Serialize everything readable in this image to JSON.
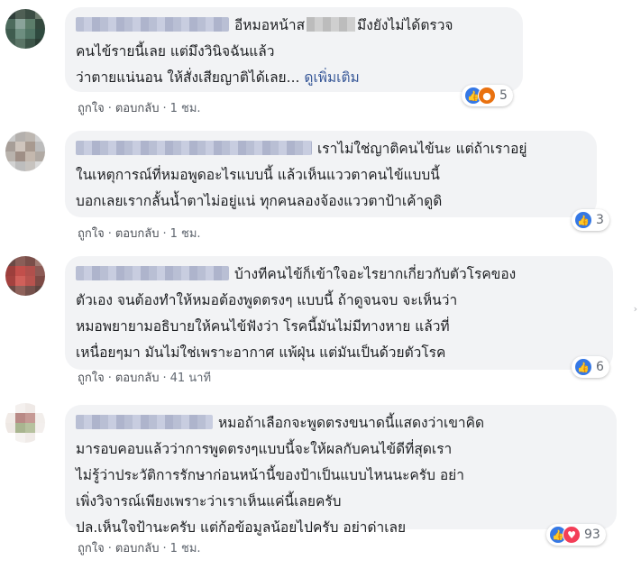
{
  "actions": {
    "like_label": "ถูกใจ",
    "reply_label": "ตอบกลับ"
  },
  "comments": [
    {
      "lines": [
        "อีหมอหน้าส",
        "มึงยังไม่ได้ตรวจ",
        "คนไข้รายนี้เลย แต่มึงวินิจฉันแล้ว",
        "ว่าตายแน่นอน ให้สั่งเสียญาติได้เลย..."
      ],
      "see_more": "ดูเพิ่มเติม",
      "reaction_count": "5",
      "time": "1 ชม."
    },
    {
      "lines": [
        "เราไม่ใช่ญาติคนไข้นะ แต่ถ้าเราอยู่",
        "ในเหตุการณ์ที่หมอพูดอะไรแบบนี้ แล้วเห็นแววตาคนไข้แบบนี้",
        "บอกเลยเรากลั้นน้ำตาไม่อยู่แน่ ทุกคนลองจ้องแววตาป้าเค้าดูดิ"
      ],
      "reaction_count": "3",
      "time": "1 ชม."
    },
    {
      "lines": [
        "บ้างทีคนไข้ก็เข้าใจอะไรยากเกี่ยวกับตัวโรคของ",
        "ตัวเอง จนต้องทำให้หมอต้องพูดตรงๆ แบบนี้ ถ้าดูจนจบ จะเห็นว่า",
        "หมอพยายามอธิบายให้คนไข้ฟังว่า โรคนี้มันไม่มีทางหาย แล้วที่",
        "เหนื่อยๆมา มันไม่ใช่เพราะอากาศ แพ้ฝุ่น แต่มันเป็นด้วยตัวโรค"
      ],
      "reaction_count": "6",
      "time": "41 นาที"
    },
    {
      "lines": [
        "หมอถ้าเลือกจะพูดตรงขนาดนี้แสดงว่าเขาคิด",
        "มารอบคอบแล้วว่าการพูดตรงๆแบบนี้จะให้ผลกับคนไข้ดีที่สุดเรา",
        "ไม่รู้ว่าประวัติการรักษาก่อนหน้านี้ของป้าเป็นแบบไหนนะครับ อย่า",
        "เพิ่งวิจารณ์เพียงเพราะว่าเราเห็นแค่นี้เลยครับ",
        "ปล.เห็นใจป้านะครับ แต่ก้อข้อมูลน้อยไปครับ อย่าด่าเลย"
      ],
      "reaction_count": "93",
      "time": "1 ชม."
    }
  ],
  "colors": {
    "bubble": "#f2f3f5",
    "link": "#385898",
    "like": "#3578e5",
    "angry": "#e9710f",
    "love": "#f33e58",
    "meta": "#606770"
  },
  "icons": {
    "like": "like-icon",
    "angry": "angry-icon",
    "love": "love-icon"
  }
}
